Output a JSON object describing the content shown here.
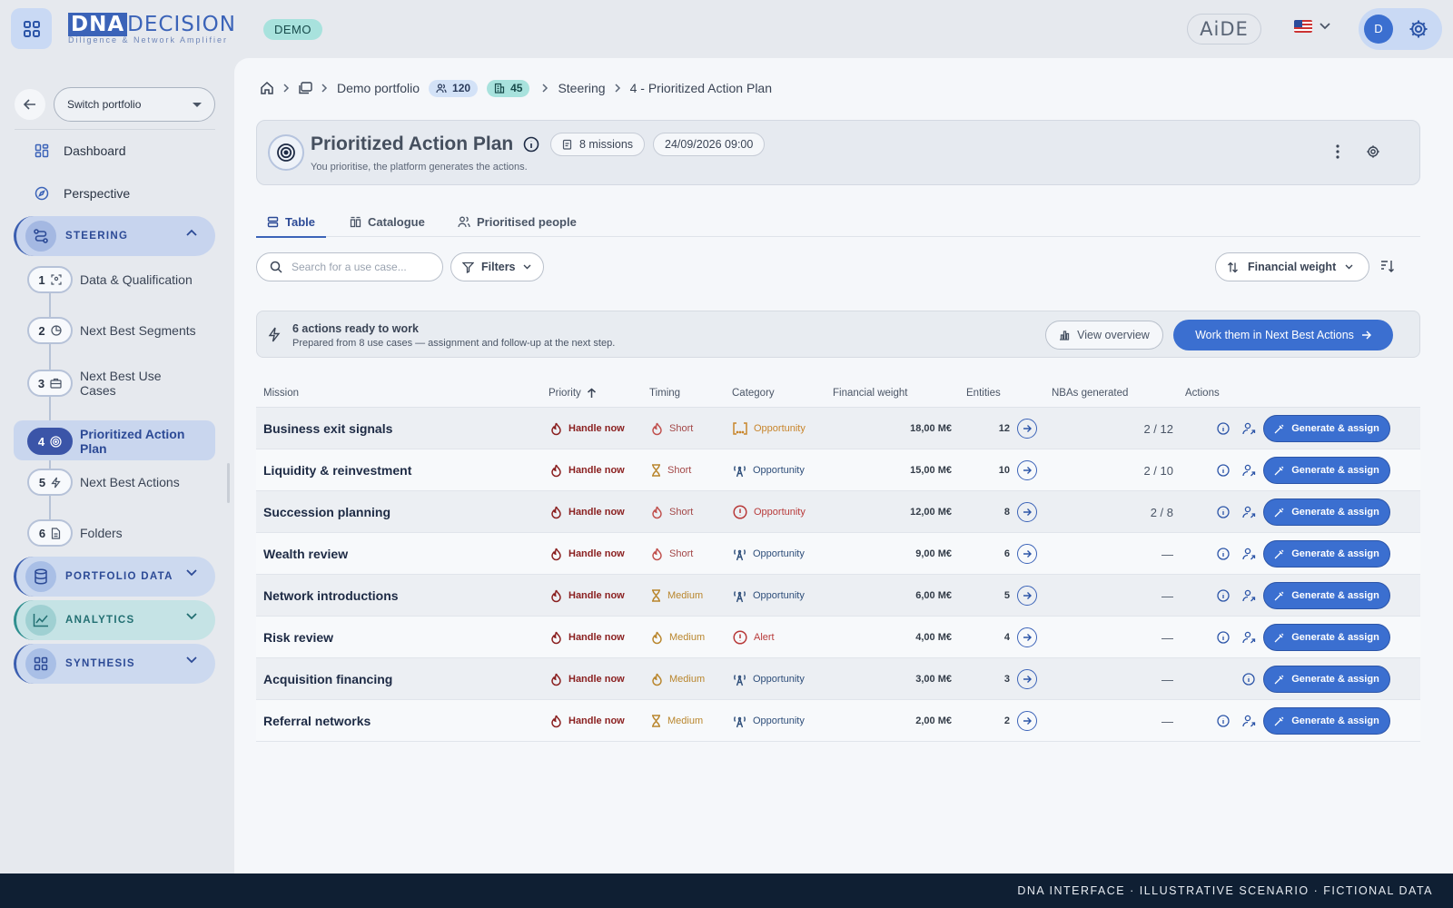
{
  "topbar": {
    "logo_dna": "DNA",
    "logo_main": "DECISION",
    "logo_sub": "Diligence & Network Amplifier",
    "demo_badge": "DEMO",
    "aide_label": "AiDE",
    "user_initial": "D"
  },
  "sidebar": {
    "switch_label": "Switch portfolio",
    "items": [
      {
        "label": "Dashboard",
        "icon": "dashboard-icon"
      },
      {
        "label": "Perspective",
        "icon": "compass-icon"
      }
    ],
    "groups": {
      "steering": "STEERING",
      "portfolio_data": "PORTFOLIO DATA",
      "analytics": "ANALYTICS",
      "synthesis": "SYNTHESIS"
    },
    "steps": [
      {
        "num": "1",
        "label": "Data & Qualification"
      },
      {
        "num": "2",
        "label": "Next Best Segments"
      },
      {
        "num": "3",
        "label": "Next Best Use Cases"
      },
      {
        "num": "4",
        "label": "Prioritized Action Plan"
      },
      {
        "num": "5",
        "label": "Next Best Actions"
      },
      {
        "num": "6",
        "label": "Folders"
      }
    ]
  },
  "breadcrumb": {
    "portfolio": "Demo portfolio",
    "people_count": "120",
    "companies_count": "45",
    "section": "Steering",
    "page": "4 - Prioritized Action Plan"
  },
  "header": {
    "title": "Prioritized Action Plan",
    "subtitle": "You prioritise, the platform generates the actions.",
    "missions_chip": "8 missions",
    "date_chip": "24/09/2026 09:00"
  },
  "tabs": [
    "Table",
    "Catalogue",
    "Prioritised people"
  ],
  "toolbar": {
    "search_placeholder": "Search for a use case...",
    "filters_label": "Filters",
    "sort_label": "Financial weight"
  },
  "banner": {
    "title": "6 actions ready to work",
    "subtitle": "Prepared from 8 use cases — assignment and follow-up at the next step.",
    "view_label": "View overview",
    "work_label": "Work them in Next Best Actions"
  },
  "table": {
    "headers": {
      "mission": "Mission",
      "priority": "Priority",
      "timing": "Timing",
      "category": "Category",
      "financial": "Financial weight",
      "entities": "Entities",
      "nbas": "NBAs generated",
      "actions": "Actions"
    },
    "generate_label": "Generate & assign",
    "rows": [
      {
        "mission": "Business exit signals",
        "priority": "Handle now",
        "timing": "Short",
        "category": "Opportunity",
        "financial": "18,00 M€",
        "entities": "12",
        "nbas": "2 / 12"
      },
      {
        "mission": "Liquidity & reinvestment",
        "priority": "Handle now",
        "timing": "Short",
        "category": "Opportunity",
        "financial": "15,00 M€",
        "entities": "10",
        "nbas": "2 / 10"
      },
      {
        "mission": "Succession planning",
        "priority": "Handle now",
        "timing": "Short",
        "category": "Opportunity",
        "financial": "12,00 M€",
        "entities": "8",
        "nbas": "2 / 8"
      },
      {
        "mission": "Wealth review",
        "priority": "Handle now",
        "timing": "Short",
        "category": "Opportunity",
        "financial": "9,00 M€",
        "entities": "6",
        "nbas": "—"
      },
      {
        "mission": "Network introductions",
        "priority": "Handle now",
        "timing": "Medium",
        "category": "Opportunity",
        "financial": "6,00 M€",
        "entities": "5",
        "nbas": "—"
      },
      {
        "mission": "Risk review",
        "priority": "Handle now",
        "timing": "Medium",
        "category": "Alert",
        "financial": "4,00 M€",
        "entities": "4",
        "nbas": "—"
      },
      {
        "mission": "Acquisition financing",
        "priority": "Handle now",
        "timing": "Medium",
        "category": "Opportunity",
        "financial": "3,00 M€",
        "entities": "3",
        "nbas": "—"
      },
      {
        "mission": "Referral networks",
        "priority": "Handle now",
        "timing": "Medium",
        "category": "Opportunity",
        "financial": "2,00 M€",
        "entities": "2",
        "nbas": "—"
      }
    ]
  },
  "footer": "DNA INTERFACE · ILLUSTRATIVE SCENARIO · FICTIONAL DATA",
  "colors": {
    "accent": "#3b6fd0",
    "priority": "#8a1f1f",
    "footer_bg": "#0f1f33"
  }
}
